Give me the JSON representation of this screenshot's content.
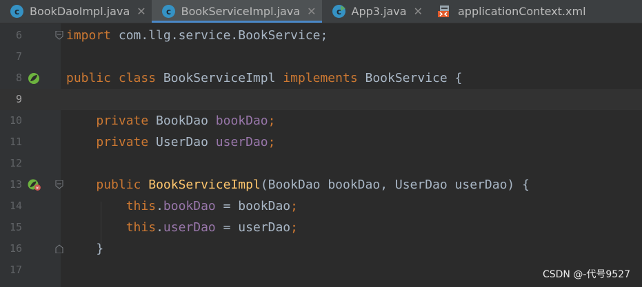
{
  "tabs": [
    {
      "label": "BookDaoImpl.java",
      "icon": "java-class-icon",
      "active": false
    },
    {
      "label": "BookServiceImpl.java",
      "icon": "java-class-icon",
      "active": true
    },
    {
      "label": "App3.java",
      "icon": "java-runnable-class-icon",
      "active": false
    },
    {
      "label": "applicationContext.xml",
      "icon": "xml-file-icon",
      "active": false
    }
  ],
  "close_glyph": "✕",
  "editor": {
    "current_line": "9",
    "lines": [
      {
        "num": "6",
        "tokens": [
          "import",
          " com.llg.service.BookService;"
        ]
      },
      {
        "num": "7",
        "tokens": []
      },
      {
        "num": "8",
        "tokens": [
          "public class",
          " BookServiceImpl ",
          "implements",
          " BookService {"
        ]
      },
      {
        "num": "9",
        "tokens": []
      },
      {
        "num": "10",
        "tokens": [
          "    ",
          "private",
          " BookDao ",
          "bookDao",
          ";"
        ]
      },
      {
        "num": "11",
        "tokens": [
          "    ",
          "private",
          " UserDao ",
          "userDao",
          ";"
        ]
      },
      {
        "num": "12",
        "tokens": []
      },
      {
        "num": "13",
        "tokens": [
          "    ",
          "public",
          " ",
          "BookServiceImpl",
          "(BookDao bookDao, UserDao userDao) {"
        ]
      },
      {
        "num": "14",
        "tokens": [
          "        ",
          "this",
          ".",
          "bookDao",
          " = bookDao",
          ";"
        ]
      },
      {
        "num": "15",
        "tokens": [
          "        ",
          "this",
          ".",
          "userDao",
          " = userDao",
          ";"
        ]
      },
      {
        "num": "16",
        "tokens": [
          "    }"
        ]
      },
      {
        "num": "17",
        "tokens": []
      }
    ]
  },
  "watermark": "CSDN @-代号9527",
  "colors": {
    "keyword": "#cc7832",
    "field": "#9876aa",
    "method": "#ffc66d",
    "text": "#a9b7c6",
    "background": "#2b2b2b",
    "gutter": "#313335",
    "tab_underline": "#4a88c7"
  }
}
